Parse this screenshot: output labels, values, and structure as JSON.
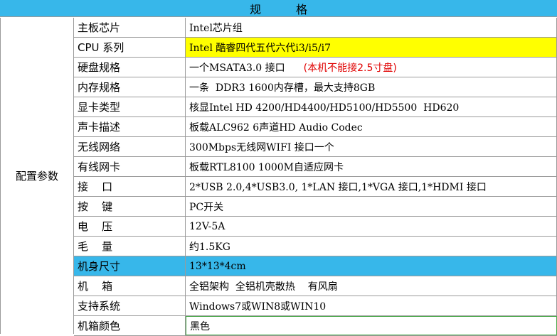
{
  "header": {
    "title": "规 格"
  },
  "section_label": "配置参数",
  "rows": [
    {
      "label": "主板芯片",
      "value": "Intel芯片组"
    },
    {
      "label": "CPU 系列",
      "value": "Intel 酷睿四代五代六代i3/i5/i7"
    },
    {
      "label": "硬盘规格",
      "value": "一个MSATA3.0 接口",
      "note": "(本机不能接2.5寸盘)"
    },
    {
      "label": "内存规格",
      "value": "一条  DDR3 1600内存槽，最大支持8GB"
    },
    {
      "label": "显卡类型",
      "value": "核显Intel HD 4200/HD4400/HD5100/HD5500  HD620"
    },
    {
      "label": "声卡描述",
      "value": "板载ALC962 6声道HD Audio Codec"
    },
    {
      "label": "无线网络",
      "value": "300Mbps无线网WIFI 接口一个"
    },
    {
      "label": "有线网卡",
      "value": "板载RTL8100 1000M自适应网卡"
    },
    {
      "label": "接    口",
      "value": "2*USB 2.0,4*USB3.0, 1*LAN 接口,1*VGA 接口,1*HDMI 接口"
    },
    {
      "label": "按    键",
      "value": "PC开关"
    },
    {
      "label": "电    压",
      "value": "12V-5A"
    },
    {
      "label": "毛    量",
      "value": "约1.5KG"
    },
    {
      "label": "机身尺寸",
      "value": "13*13*4cm"
    },
    {
      "label": "机    箱",
      "value": "全铝架构  全铝机壳散热    有风扇"
    },
    {
      "label": "支持系统",
      "value": "Windows7或WIN8或WIN10"
    },
    {
      "label": "机箱颜色",
      "value": "黑色"
    }
  ],
  "colors": {
    "header_bg": "#37b7ea",
    "highlight_yellow": "#ffff00",
    "note_red": "#e00000"
  }
}
